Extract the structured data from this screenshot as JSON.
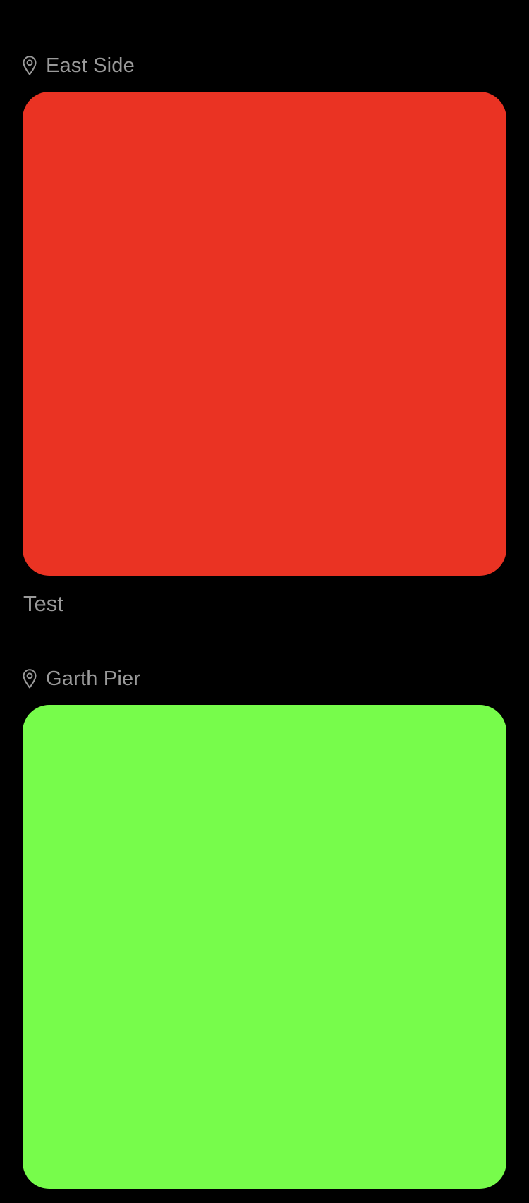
{
  "feed": {
    "posts": [
      {
        "location": "East Side",
        "location_icon": "map-pin-icon",
        "photo_color": "#EA3323",
        "caption": "Test"
      },
      {
        "location": "Garth Pier",
        "location_icon": "map-pin-icon",
        "photo_color": "#77FC4B",
        "caption": ""
      }
    ]
  },
  "colors": {
    "background": "#000000",
    "secondary_text": "#9A9A9A"
  }
}
